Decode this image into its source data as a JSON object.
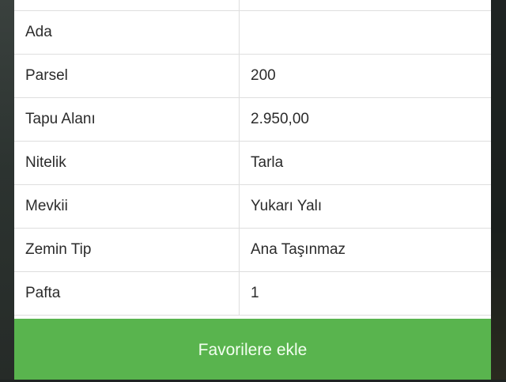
{
  "details": {
    "rows": [
      {
        "label": "",
        "value": ""
      },
      {
        "label": "Ada",
        "value": ""
      },
      {
        "label": "Parsel",
        "value": "200"
      },
      {
        "label": "Tapu Alanı",
        "value": "2.950,00"
      },
      {
        "label": "Nitelik",
        "value": "Tarla"
      },
      {
        "label": "Mevkii",
        "value": "Yukarı Yalı"
      },
      {
        "label": "Zemin Tip",
        "value": "Ana Taşınmaz"
      },
      {
        "label": "Pafta",
        "value": "1"
      }
    ]
  },
  "actions": {
    "favorite_label": "Favorilere ekle"
  },
  "colors": {
    "button_green": "#59b44e",
    "border": "#dedede",
    "text": "#2b2b2b"
  }
}
